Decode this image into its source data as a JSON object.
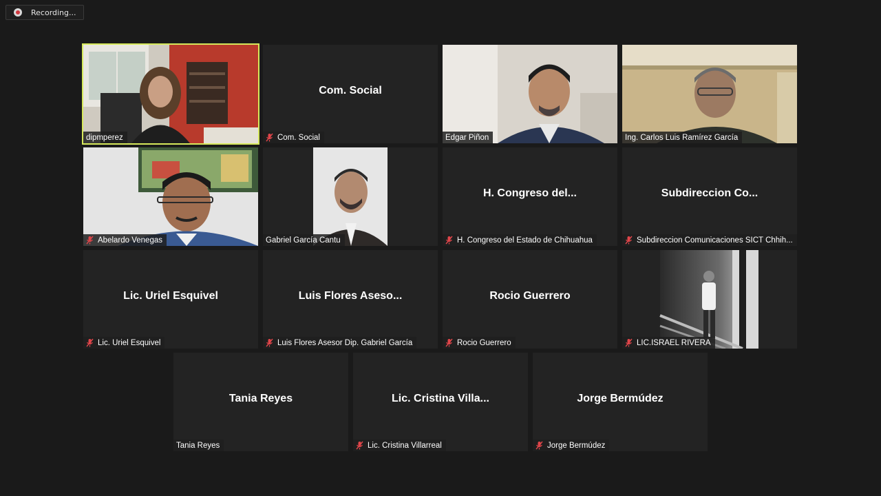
{
  "recording": {
    "label": "Recording...",
    "icon": "recording-dot-icon"
  },
  "participants": [
    {
      "name": "dipmperez",
      "muted": false,
      "active": true,
      "video": true
    },
    {
      "display": "Com. Social",
      "name": "Com. Social",
      "muted": true
    },
    {
      "name": "Edgar Piñon",
      "muted": false,
      "video": true
    },
    {
      "name": "Ing. Carlos Luis Ramírez García",
      "muted": false,
      "video": true
    },
    {
      "name": "Abelardo Venegas",
      "muted": true,
      "video": true
    },
    {
      "name": "Gabriel García Cantu",
      "muted": false,
      "video": true
    },
    {
      "display": "H. Congreso del...",
      "name": "H. Congreso del Estado de Chihuahua",
      "muted": true
    },
    {
      "display": "Subdireccion Co...",
      "name": "Subdireccion Comunicaciones SICT Chhih...",
      "muted": true
    },
    {
      "display": "Lic. Uriel Esquivel",
      "name": "Lic. Uriel Esquivel",
      "muted": true
    },
    {
      "display": "Luis Flores Aseso...",
      "name": "Luis Flores Asesor Dip. Gabriel García",
      "muted": true
    },
    {
      "display": "Rocio Guerrero",
      "name": "Rocio Guerrero",
      "muted": true
    },
    {
      "name": "LIC.ISRAEL RIVERA",
      "muted": true,
      "video": true
    },
    {
      "display": "Tania Reyes",
      "name": "Tania Reyes",
      "muted": false
    },
    {
      "display": "Lic. Cristina Villa...",
      "name": "Lic. Cristina Villarreal",
      "muted": true
    },
    {
      "display": "Jorge Bermúdez",
      "name": "Jorge Bermúdez",
      "muted": true
    }
  ],
  "colors": {
    "active_outline": "#d6e95b",
    "muted_icon": "#e0454a",
    "tile_bg": "#232323"
  }
}
